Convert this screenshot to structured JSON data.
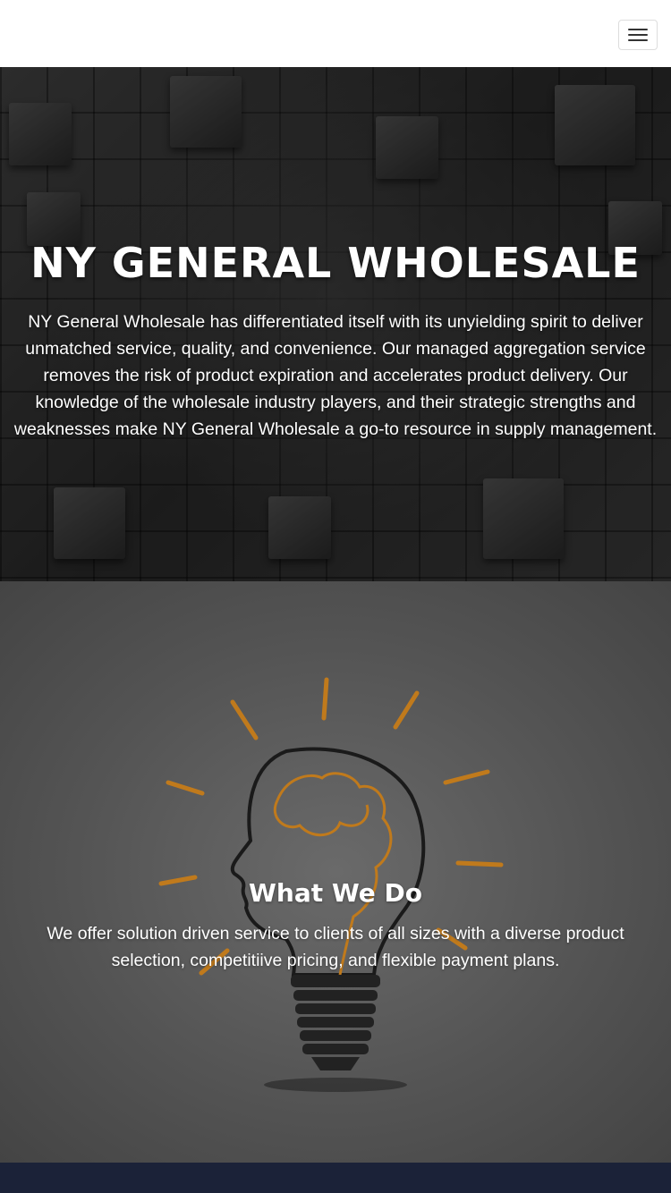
{
  "navbar": {
    "toggle_icon": "hamburger-menu-icon"
  },
  "hero": {
    "title": "NY GENERAL WHOLESALE",
    "text": "NY General Wholesale has differentiated itself with its unyielding spirit to deliver unmatched service, quality, and convenience. Our managed aggregation service removes the risk of product expiration and accelerates product delivery. Our knowledge of the wholesale industry players, and their strategic strengths and weaknesses make NY General Wholesale a go-to resource in supply management."
  },
  "what_we_do": {
    "title": "What We Do",
    "text": "We offer solution driven service to clients of all sizes with a diverse product selection, competitiive pricing, and flexible payment plans.",
    "image_icon": "lightbulb-head-illustration"
  },
  "colors": {
    "footer_bg": "#1b2238",
    "bulb_accent": "#c07a1c"
  }
}
